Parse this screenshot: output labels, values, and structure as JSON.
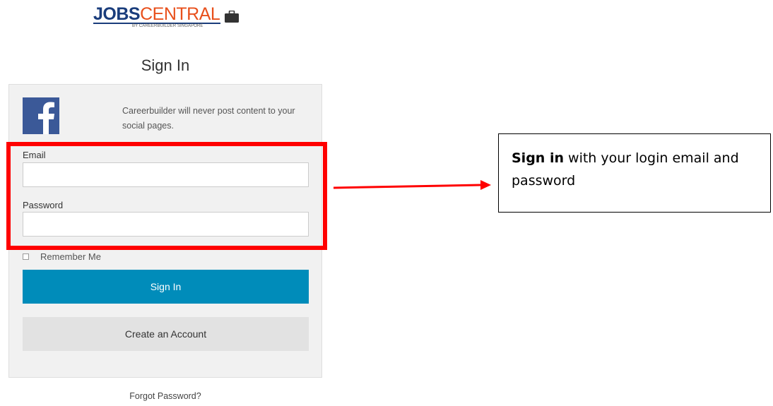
{
  "logo": {
    "part_one": "JOBS",
    "part_two": "CENTRAL",
    "tagline": "BY CAREERBUILDER SINGAPORE",
    "icon": "briefcase-icon",
    "colors": {
      "jobs": "#1a3d7c",
      "central": "#e8501c"
    }
  },
  "page_title": "Sign In",
  "facebook": {
    "icon": "facebook-icon",
    "note": "Careerbuilder will never post content to your social pages.",
    "color": "#3b5998"
  },
  "form": {
    "email_label": "Email",
    "email_value": "",
    "password_label": "Password",
    "password_value": "",
    "remember_label": "Remember Me",
    "remember_checked": false,
    "sign_in_label": "Sign In",
    "create_account_label": "Create an Account",
    "forgot_label": "Forgot Password?"
  },
  "annotation": {
    "callout_bold": "Sign in",
    "callout_rest": " with your login email and password",
    "highlight_color": "#ff0000"
  },
  "colors": {
    "primary_button": "#008cba",
    "secondary_button": "#e2e2e2",
    "card_background": "#f1f1f1"
  }
}
